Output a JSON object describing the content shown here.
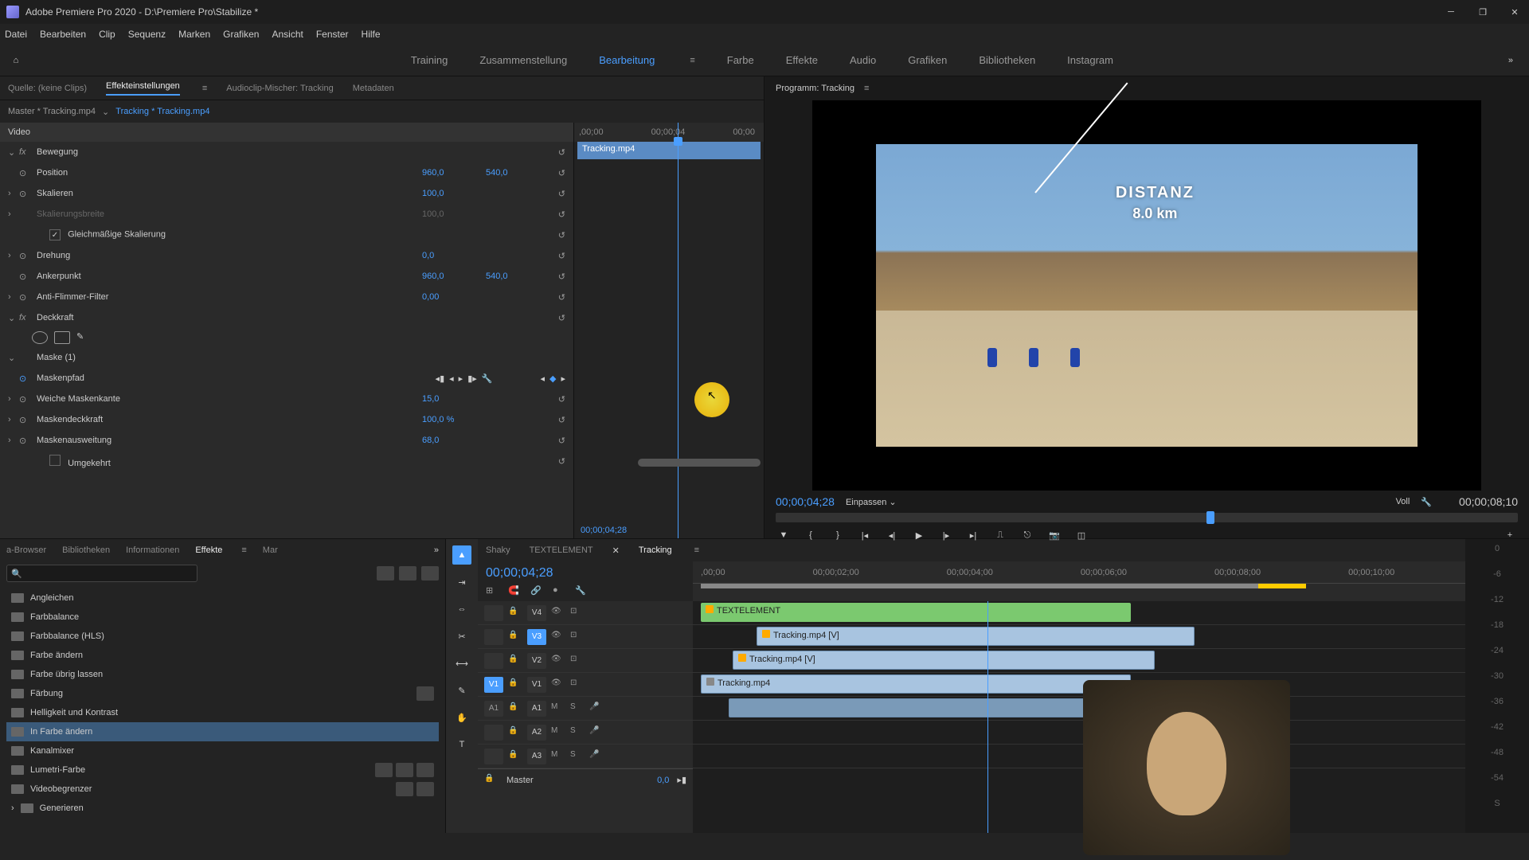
{
  "title": "Adobe Premiere Pro 2020 - D:\\Premiere Pro\\Stabilize *",
  "menu": [
    "Datei",
    "Bearbeiten",
    "Clip",
    "Sequenz",
    "Marken",
    "Grafiken",
    "Ansicht",
    "Fenster",
    "Hilfe"
  ],
  "workspaces": [
    "Training",
    "Zusammenstellung",
    "Bearbeitung",
    "Farbe",
    "Effekte",
    "Audio",
    "Grafiken",
    "Bibliotheken",
    "Instagram"
  ],
  "source_tabs": {
    "quelle": "Quelle: (keine Clips)",
    "effekt": "Effekteinstellungen",
    "audio": "Audioclip-Mischer: Tracking",
    "meta": "Metadaten"
  },
  "breadcrumb": {
    "master": "Master * Tracking.mp4",
    "clip": "Tracking * Tracking.mp4"
  },
  "mini_ruler": [
    ",00;00",
    "00;00;04",
    "00;00"
  ],
  "mini_clip": "Tracking.mp4",
  "mini_tc": "00;00;04;28",
  "props": {
    "video_hdr": "Video",
    "bewegung": "Bewegung",
    "position": "Position",
    "position_x": "960,0",
    "position_y": "540,0",
    "skalieren": "Skalieren",
    "skalieren_v": "100,0",
    "skalierungsbreite": "Skalierungsbreite",
    "skalierungsbreite_v": "100,0",
    "gleichmaessig": "Gleichmäßige Skalierung",
    "drehung": "Drehung",
    "drehung_v": "0,0",
    "ankerpunkt": "Ankerpunkt",
    "anker_x": "960,0",
    "anker_y": "540,0",
    "antiflimmer": "Anti-Flimmer-Filter",
    "antiflimmer_v": "0,00",
    "deckkraft": "Deckkraft",
    "maske": "Maske (1)",
    "maskenpfad": "Maskenpfad",
    "weiche": "Weiche Maskenkante",
    "weiche_v": "15,0",
    "maskendeck": "Maskendeckkraft",
    "maskendeck_v": "100,0 %",
    "maskenausw": "Maskenausweitung",
    "maskenausw_v": "68,0",
    "umgekehrt": "Umgekehrt"
  },
  "program": {
    "title": "Programm: Tracking",
    "tc": "00;00;04;28",
    "fit": "Einpassen",
    "scale": "Voll",
    "duration": "00;00;08;10",
    "overlay1": "DISTANZ",
    "overlay2": "8.0 km"
  },
  "browser_tabs": {
    "a": "a-Browser",
    "bib": "Bibliotheken",
    "info": "Informationen",
    "effekte": "Effekte",
    "mar": "Mar"
  },
  "fx_list": [
    "Angleichen",
    "Farbbalance",
    "Farbbalance (HLS)",
    "Farbe ändern",
    "Farbe übrig lassen",
    "Färbung",
    "Helligkeit und Kontrast",
    "In Farbe ändern",
    "Kanalmixer",
    "Lumetri-Farbe",
    "Videobegrenzer",
    "Generieren"
  ],
  "timeline": {
    "tabs": [
      "Shaky",
      "TEXTELEMENT",
      "Tracking"
    ],
    "tc": "00;00;04;28",
    "ruler": [
      ",00;00",
      "00;00;02;00",
      "00;00;04;00",
      "00;00;06;00",
      "00;00;08;00",
      "00;00;10;00"
    ],
    "tracks_v": [
      "V4",
      "V3",
      "V2",
      "V1"
    ],
    "tracks_a": [
      "A1",
      "A2",
      "A3"
    ],
    "master": "Master",
    "master_v": "0,0",
    "clips": {
      "text": "TEXTELEMENT",
      "trk1": "Tracking.mp4 [V]",
      "trk2": "Tracking.mp4 [V]",
      "trk3": "Tracking.mp4"
    }
  }
}
